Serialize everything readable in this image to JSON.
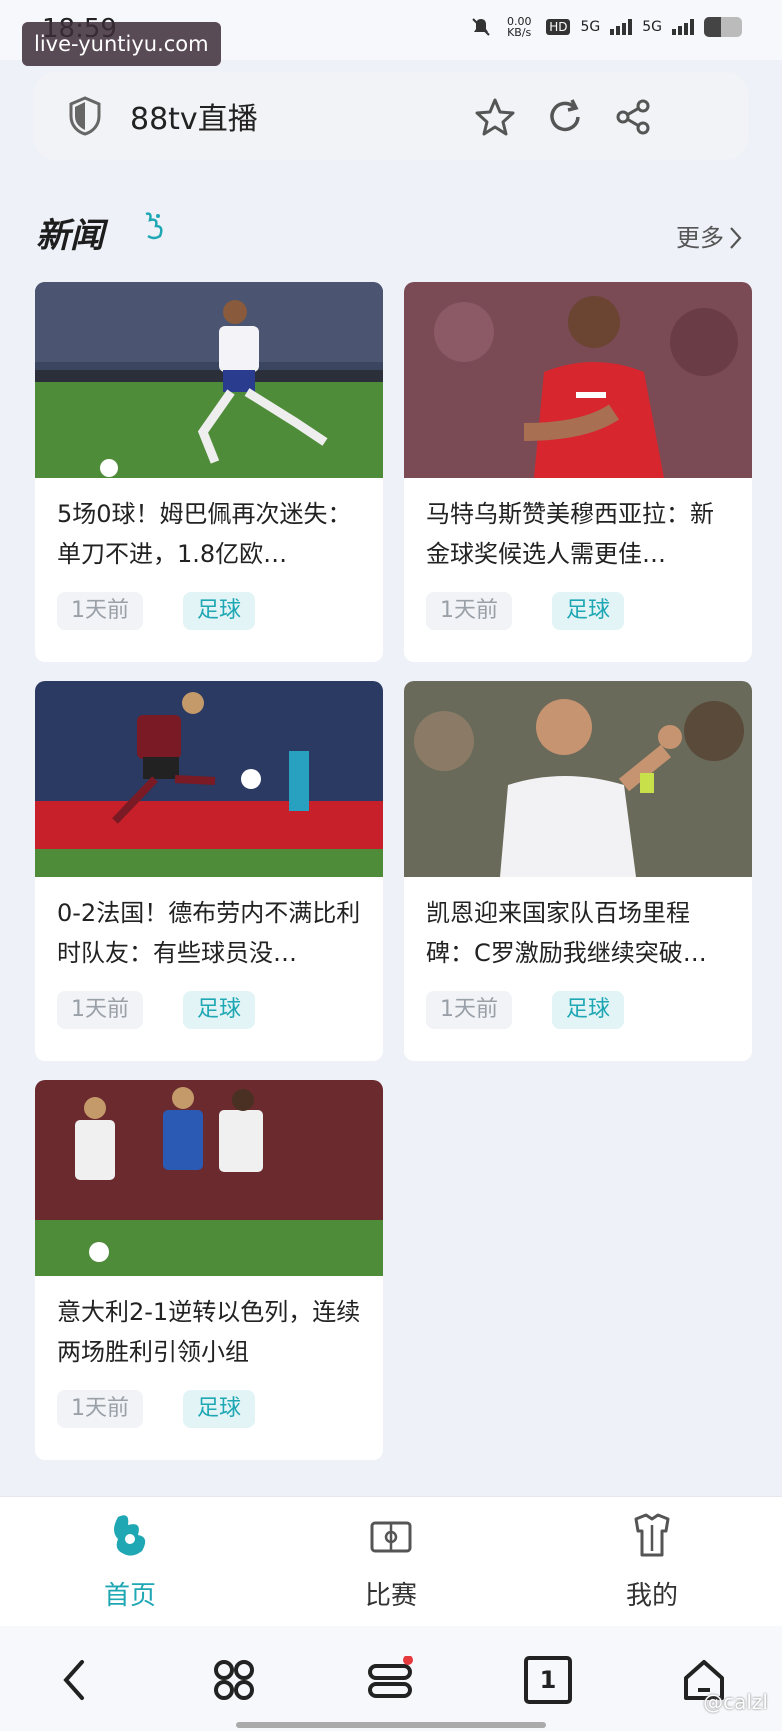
{
  "status": {
    "time": "18:59",
    "watermark": "live-yuntiyu.com",
    "net_speed": "0.00 KB/s",
    "hd": "HD",
    "sig1": "5G",
    "sig2": "5G",
    "battery_level": 0.45,
    "icons": [
      "bell-off-icon",
      "hd-icon",
      "signal-icon",
      "signal-icon",
      "battery-icon"
    ]
  },
  "addressbar": {
    "title": "88tv直播",
    "icons": [
      "shield-icon",
      "star-icon",
      "refresh-icon",
      "share-icon"
    ]
  },
  "section": {
    "title": "新闻",
    "more": "更多",
    "icons": [
      "logo-icon",
      "chevron-right-icon"
    ]
  },
  "news": [
    {
      "headline": "5场0球！姆巴佩再次迷失：单刀不进，1.8亿欧…",
      "time": "1天前",
      "tag": "足球",
      "image": "player-photo-france"
    },
    {
      "headline": "马特乌斯赞美穆西亚拉：新金球奖候选人需更佳…",
      "time": "1天前",
      "tag": "足球",
      "image": "player-photo-bayern"
    },
    {
      "headline": "0-2法国！德布劳内不满比利时队友：有些球员没…",
      "time": "1天前",
      "tag": "足球",
      "image": "player-photo-belgium"
    },
    {
      "headline": "凯恩迎来国家队百场里程碑：C罗激励我继续突破…",
      "time": "1天前",
      "tag": "足球",
      "image": "player-photo-england"
    },
    {
      "headline": "意大利2-1逆转以色列，连续两场胜利引领小组",
      "time": "1天前",
      "tag": "足球",
      "image": "player-photo-italy"
    }
  ],
  "tabbar": {
    "items": [
      {
        "label": "首页",
        "icon": "home-logo-icon",
        "active": true
      },
      {
        "label": "比赛",
        "icon": "match-icon",
        "active": false
      },
      {
        "label": "我的",
        "icon": "profile-icon",
        "active": false
      }
    ]
  },
  "sysbar": {
    "tab_count": "1",
    "icons": [
      "back-icon",
      "apps-icon",
      "menu-icon",
      "tabs-icon",
      "home-icon"
    ]
  },
  "footer_watermark": "@calzl",
  "colors": {
    "accent": "#1fa8b4",
    "bg": "#eef1f8"
  }
}
